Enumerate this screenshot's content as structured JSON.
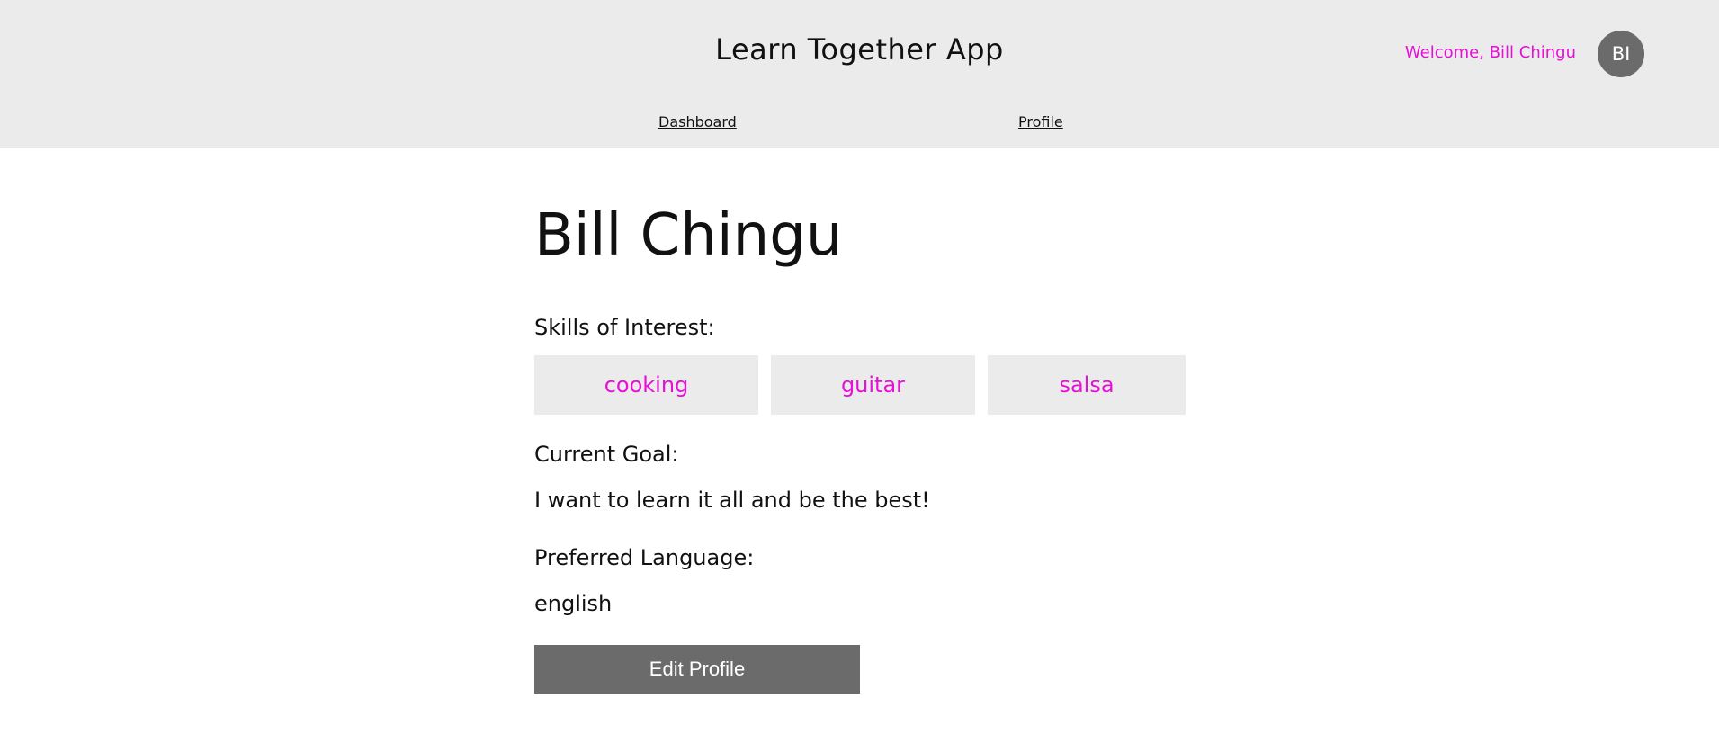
{
  "header": {
    "app_title": "Learn Together App",
    "welcome_text": "Welcome, Bill Chingu",
    "avatar_initials": "BI",
    "nav": {
      "dashboard_label": "Dashboard",
      "profile_label": "Profile"
    }
  },
  "profile": {
    "name": "Bill Chingu",
    "skills_label": "Skills of Interest:",
    "skills": [
      "cooking",
      "guitar",
      "salsa"
    ],
    "goal_label": "Current Goal:",
    "goal_value": "I want to learn it all and be the best!",
    "language_label": "Preferred Language:",
    "language_value": "english",
    "edit_button_label": "Edit Profile"
  },
  "colors": {
    "header_bg": "#ebebeb",
    "accent": "#e610d6",
    "button_bg": "#6b6b6b",
    "avatar_bg": "#6b6b6b"
  }
}
